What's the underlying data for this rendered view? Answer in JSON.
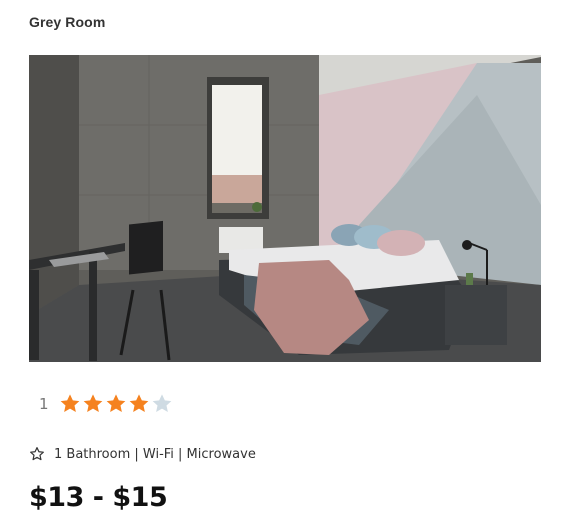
{
  "room": {
    "title": "Grey Room",
    "image_alt": "Grey concrete bedroom with bed, desk and window",
    "rating": {
      "count": "1",
      "value": 4,
      "max": 5,
      "filled_color": "#f5821f",
      "empty_color": "#cfdbe3"
    },
    "amenities_icon": "star-outline-icon",
    "amenities": "1 Bathroom | Wi-Fi | Microwave",
    "price": "$13 - $15"
  }
}
